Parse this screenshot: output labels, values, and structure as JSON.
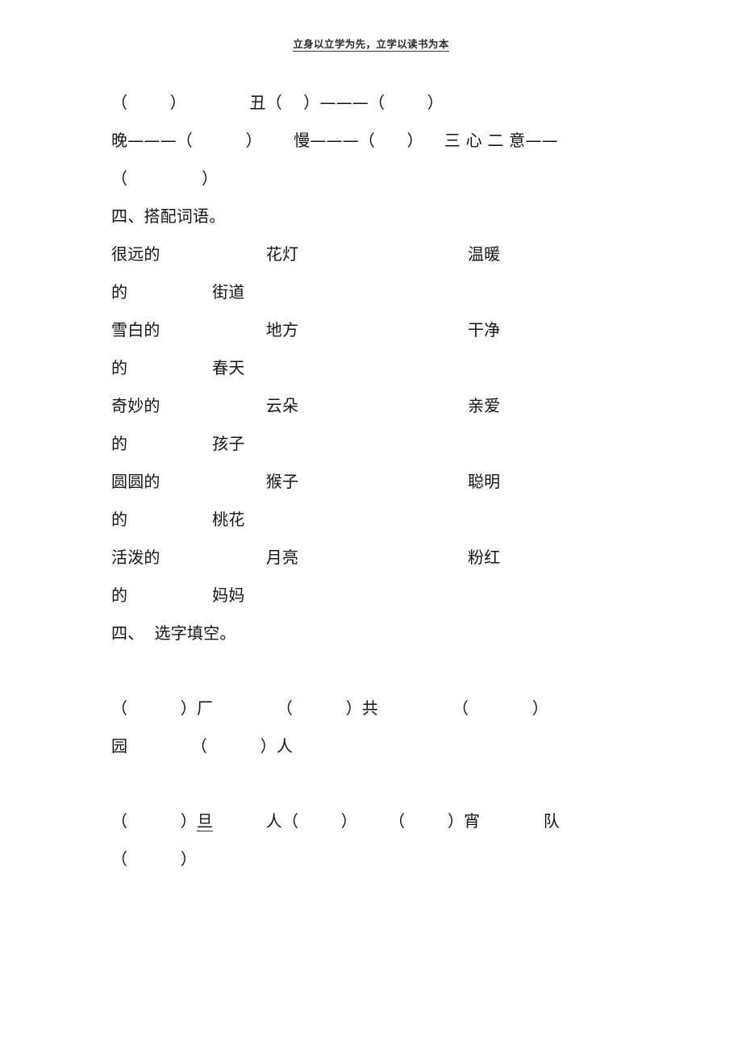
{
  "header": {
    "running_text": "立身以立学为先，立学以读书为本"
  },
  "exercise_top": {
    "line1": "（        ）            丑（    ）———（        ）",
    "line2": "晚———（          ）      慢———（      ）    三 心 二 意——",
    "line3": "（              ）"
  },
  "section_match": {
    "heading": "四、搭配词语。",
    "rows": [
      {
        "left": "很远的",
        "middle": "花灯",
        "right": "温暖",
        "wrap_left": "的",
        "wrap_middle": "街道"
      },
      {
        "left": "雪白的",
        "middle": "地方",
        "right": "干净",
        "wrap_left": "的",
        "wrap_middle": "春天"
      },
      {
        "left": "奇妙的",
        "middle": "云朵",
        "right": "亲爱",
        "wrap_left": "的",
        "wrap_middle": "孩子"
      },
      {
        "left": "圆圆的",
        "middle": "猴子",
        "right": "聪明",
        "wrap_left": "的",
        "wrap_middle": "桃花"
      },
      {
        "left": "活泼的",
        "middle": "月亮",
        "right": "粉红",
        "wrap_left": "的",
        "wrap_middle": "妈妈"
      }
    ],
    "rendered_lines": [
      "很远的                    花灯                                温暖",
      "的                街道",
      "雪白的                    地方                                干净",
      "的                春天",
      "奇妙的                    云朵                                亲爱",
      "的                孩子",
      "圆圆的                    猴子                                聪明",
      "的                桃花",
      "活泼的                    月亮                                粉红",
      "的                妈妈"
    ]
  },
  "section_fill": {
    "heading": "四、  选字填空。",
    "line1_a": "（          ）厂            （          ）共              （            ）",
    "line1_b": "园            （          ）人",
    "line2_a_pre": "（          ）",
    "line2_a_char": "旦",
    "line2_a_post": "          人（        ）      （        ）宵            队",
    "line2_b": "（          ）"
  }
}
